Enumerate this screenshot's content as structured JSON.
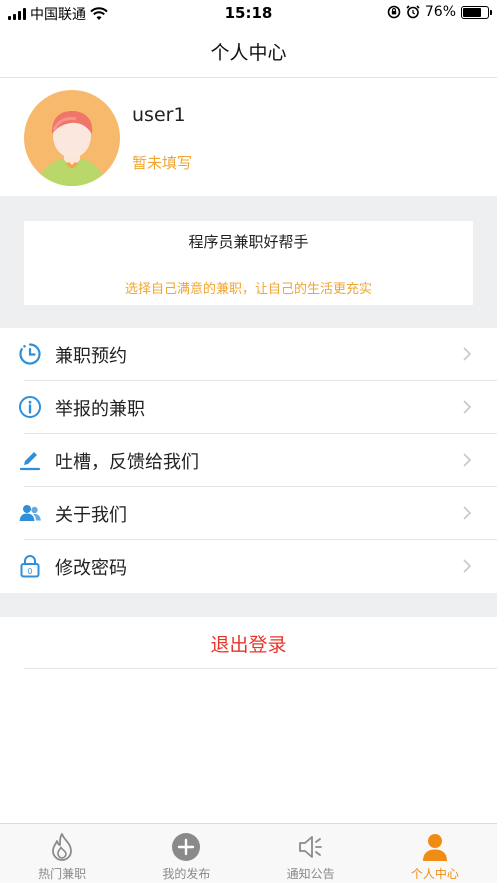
{
  "status_bar": {
    "carrier": "中国联通",
    "time": "15:18",
    "battery": "76%"
  },
  "header": {
    "title": "个人中心"
  },
  "profile": {
    "username": "user1",
    "subtitle": "暂未填写"
  },
  "banner": {
    "title": "程序员兼职好帮手",
    "subtitle": "选择自己满意的兼职，让自己的生活更充实"
  },
  "menu": {
    "items": [
      {
        "label": "兼职预约",
        "icon": "clock-icon"
      },
      {
        "label": "举报的兼职",
        "icon": "info-icon"
      },
      {
        "label": "吐槽，反馈给我们",
        "icon": "edit-icon"
      },
      {
        "label": "关于我们",
        "icon": "users-icon"
      },
      {
        "label": "修改密码",
        "icon": "lock-icon"
      }
    ]
  },
  "logout": {
    "label": "退出登录"
  },
  "tabbar": {
    "items": [
      {
        "label": "热门兼职",
        "icon": "flame-icon"
      },
      {
        "label": "我的发布",
        "icon": "plus-circle-icon"
      },
      {
        "label": "通知公告",
        "icon": "speaker-icon"
      },
      {
        "label": "个人中心",
        "icon": "person-icon",
        "active": true
      }
    ]
  },
  "colors": {
    "accent": "#f08c14",
    "subtitle": "#f0a531",
    "icon_blue": "#2f8fd8",
    "danger": "#e8362b",
    "band": "#eeeff1"
  }
}
